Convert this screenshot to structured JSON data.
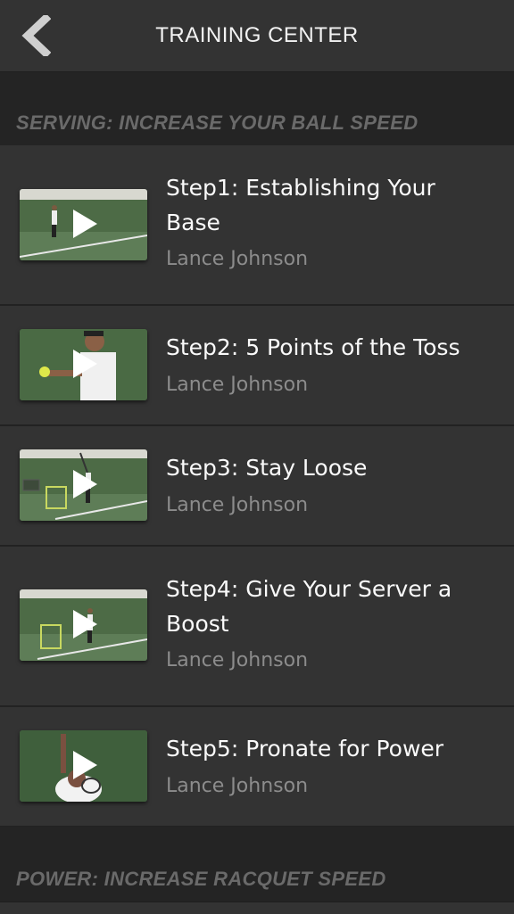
{
  "header": {
    "title": "TRAINING CENTER",
    "back_icon": "chevron-left-icon"
  },
  "sections": [
    {
      "title": "SERVING: INCREASE YOUR BALL SPEED",
      "items": [
        {
          "title": "Step1: Establishing Your Base",
          "author": "Lance Johnson"
        },
        {
          "title": "Step2: 5 Points of the Toss",
          "author": "Lance Johnson"
        },
        {
          "title": "Step3: Stay Loose",
          "author": "Lance Johnson"
        },
        {
          "title": "Step4: Give Your Server a Boost",
          "author": "Lance Johnson"
        },
        {
          "title": "Step5: Pronate for Power",
          "author": "Lance Johnson"
        }
      ]
    },
    {
      "title": "POWER: INCREASE RACQUET SPEED",
      "items": []
    }
  ],
  "colors": {
    "background": "#2b2b2b",
    "row": "#333333",
    "section_header_text": "#6a6a6a",
    "subtitle": "#8c8c8c",
    "court_green": "#3c5a3a"
  },
  "icons": {
    "play": "play-icon"
  }
}
